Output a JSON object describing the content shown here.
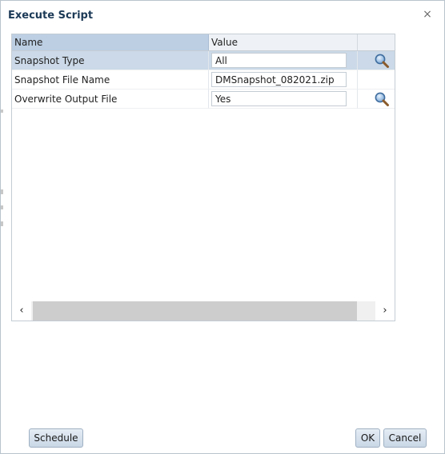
{
  "dialog": {
    "title": "Execute Script",
    "close_glyph": "×"
  },
  "grid": {
    "columns": {
      "name": "Name",
      "value": "Value"
    },
    "rows": [
      {
        "name": "Snapshot Type",
        "value": "All",
        "has_search": true,
        "selected": true
      },
      {
        "name": "Snapshot File Name",
        "value": "DMSnapshot_082021.zip",
        "has_search": false,
        "selected": false
      },
      {
        "name": "Overwrite Output File",
        "value": "Yes",
        "has_search": true,
        "selected": false
      }
    ],
    "scroll": {
      "left_glyph": "‹",
      "right_glyph": "›"
    }
  },
  "buttons": {
    "schedule": "Schedule",
    "ok": "OK",
    "cancel": "Cancel"
  },
  "icons": {
    "search": "magnifier-search-icon",
    "close": "close-icon"
  },
  "colors": {
    "title": "#1c3a57",
    "selected_row": "#cbd9e8",
    "header_sorted": "#bccfe3",
    "button_border": "#9fb1c4"
  }
}
